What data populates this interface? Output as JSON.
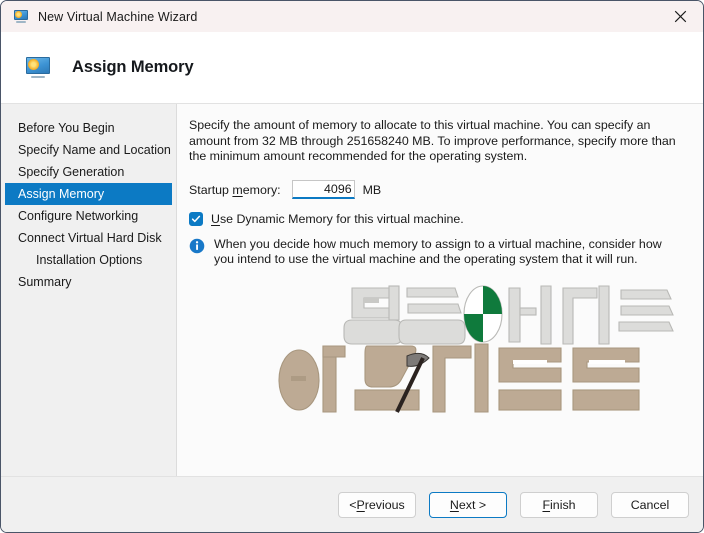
{
  "titlebar": {
    "title": "New Virtual Machine Wizard",
    "icon": "vm-monitor-icon",
    "close_label": "×"
  },
  "header": {
    "title": "Assign Memory",
    "icon": "vm-monitor-icon"
  },
  "sidebar": {
    "items": [
      {
        "label": "Before You Begin",
        "selected": false,
        "indent": false
      },
      {
        "label": "Specify Name and Location",
        "selected": false,
        "indent": false
      },
      {
        "label": "Specify Generation",
        "selected": false,
        "indent": false
      },
      {
        "label": "Assign Memory",
        "selected": true,
        "indent": false
      },
      {
        "label": "Configure Networking",
        "selected": false,
        "indent": false
      },
      {
        "label": "Connect Virtual Hard Disk",
        "selected": false,
        "indent": false
      },
      {
        "label": "Installation Options",
        "selected": false,
        "indent": true
      },
      {
        "label": "Summary",
        "selected": false,
        "indent": false
      }
    ]
  },
  "main": {
    "description": "Specify the amount of memory to allocate to this virtual machine. You can specify an amount from 32 MB through 251658240 MB. To improve performance, specify more than the minimum amount recommended for the operating system.",
    "startup_memory_label": "Startup memory:",
    "startup_memory_label_accel": "m",
    "startup_memory_value": "4096",
    "startup_memory_placeholder": "",
    "startup_memory_unit": "MB",
    "dynamic_memory_checkbox": {
      "label": "Use Dynamic Memory for this virtual machine.",
      "accel": "U",
      "checked": true
    },
    "info": {
      "icon": "info-circle-icon",
      "text": "When you decide how much memory to assign to a virtual machine, consider how you intend to use the virtual machine and the operating system that it will run."
    },
    "watermark": {
      "line1": "만들어가는",
      "line2": "아스가르드",
      "line1_color": "#dcdcda",
      "line2_color": "#bdaa94",
      "accent_green": "#0f7a3c",
      "axe_color": "#2b2320"
    }
  },
  "footer": {
    "buttons": [
      {
        "label": "< Previous",
        "accel": "P",
        "focused": false,
        "name": "previous-button"
      },
      {
        "label": "Next >",
        "accel": "N",
        "focused": true,
        "name": "next-button"
      },
      {
        "label": "Finish",
        "accel": "F",
        "focused": false,
        "name": "finish-button"
      },
      {
        "label": "Cancel",
        "accel": "",
        "focused": false,
        "name": "cancel-button"
      }
    ]
  },
  "colors": {
    "titlebar_bg": "#f8f1f1",
    "accent_blue": "#0c7ac4",
    "sidebar_bg": "#f0f0f0",
    "content_bg": "#fbfbfb",
    "footer_bg": "#f0f0f0",
    "window_border": "#4a5568"
  }
}
